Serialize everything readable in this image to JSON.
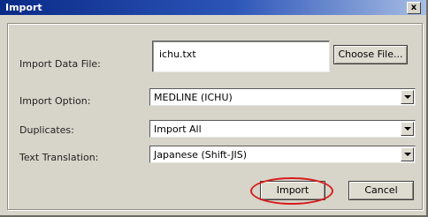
{
  "window": {
    "title": "Import",
    "close_label": "x"
  },
  "form": {
    "data_file": {
      "label": "Import Data File:",
      "value": "ichu.txt",
      "button_label": "Choose File..."
    },
    "import_option": {
      "label": "Import Option:",
      "value": "MEDLINE (ICHU)"
    },
    "duplicates": {
      "label": "Duplicates:",
      "value": "Import All"
    },
    "text_translation": {
      "label": "Text Translation:",
      "value": "Japanese (Shift-JIS)"
    }
  },
  "buttons": {
    "import_label": "Import",
    "cancel_label": "Cancel"
  },
  "annotation": {
    "highlight_color": "#d81c1c",
    "highlight_target": "Import"
  }
}
